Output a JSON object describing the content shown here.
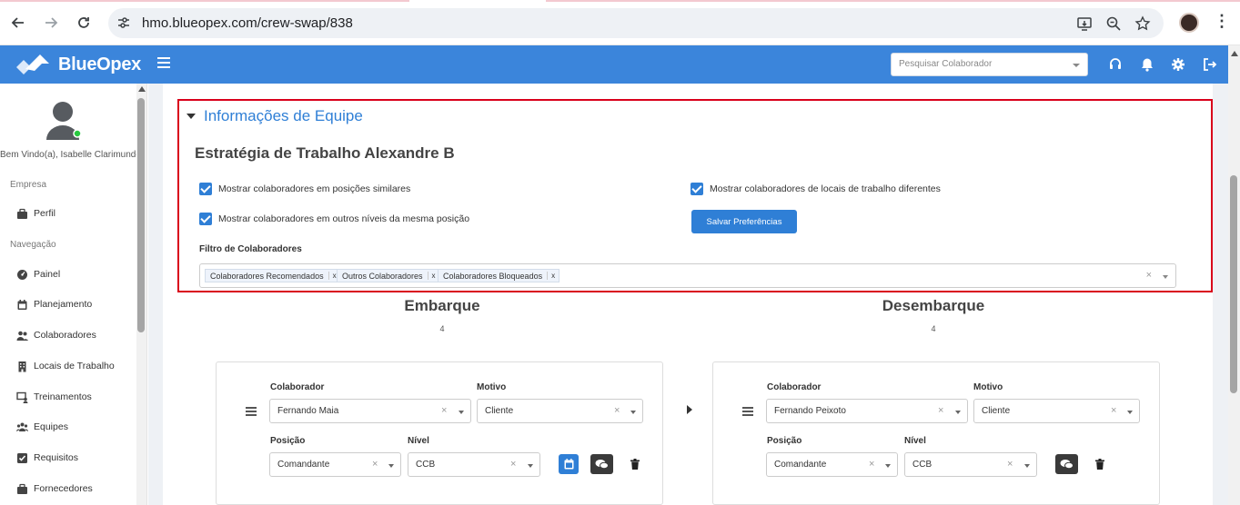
{
  "browser": {
    "url": "hmo.blueopex.com/crew-swap/838"
  },
  "app": {
    "brand": "BlueOpex",
    "brand_color": "#3b85db",
    "search_placeholder": "Pesquisar Colaborador"
  },
  "sidebar": {
    "welcome": "Bem Vindo(a), Isabelle Clarimundo",
    "section_company": "Empresa",
    "section_nav": "Navegação",
    "items": [
      {
        "label": "Perfil",
        "icon": "briefcase-icon"
      },
      {
        "label": "Painel",
        "icon": "dashboard-icon"
      },
      {
        "label": "Planejamento",
        "icon": "calendar-icon"
      },
      {
        "label": "Colaboradores",
        "icon": "users-icon"
      },
      {
        "label": "Locais de Trabalho",
        "icon": "building-icon"
      },
      {
        "label": "Treinamentos",
        "icon": "presentation-icon"
      },
      {
        "label": "Equipes",
        "icon": "team-icon"
      },
      {
        "label": "Requisitos",
        "icon": "checkbox-icon"
      },
      {
        "label": "Fornecedores",
        "icon": "briefcase-icon"
      }
    ]
  },
  "team_info": {
    "section_title": "Informações de Equipe",
    "strategy_title": "Estratégia de Trabalho Alexandre B",
    "options": [
      {
        "label": "Mostrar colaboradores em posições similares",
        "checked": true
      },
      {
        "label": "Mostrar colaboradores em outros níveis da mesma posição",
        "checked": true
      },
      {
        "label": "Mostrar colaboradores de locais de trabalho diferentes",
        "checked": true
      }
    ],
    "save_label": "Salvar Preferências",
    "filter_label": "Filtro de Colaboradores",
    "filter_tags": [
      "Colaboradores Recomendados",
      "Outros Colaboradores",
      "Colaboradores Bloqueados"
    ],
    "tag_remove": "x",
    "clear_symbol": "×"
  },
  "embarque": {
    "title": "Embarque",
    "count": "4",
    "labels": {
      "colaborador": "Colaborador",
      "motivo": "Motivo",
      "posicao": "Posição",
      "nivel": "Nível"
    },
    "colaborador": "Fernando Maia",
    "motivo": "Cliente",
    "posicao": "Comandante",
    "nivel": "CCB"
  },
  "desembarque": {
    "title": "Desembarque",
    "count": "4",
    "labels": {
      "colaborador": "Colaborador",
      "motivo": "Motivo",
      "posicao": "Posição",
      "nivel": "Nível"
    },
    "colaborador": "Fernando Peixoto",
    "motivo": "Cliente",
    "posicao": "Comandante",
    "nivel": "CCB"
  }
}
